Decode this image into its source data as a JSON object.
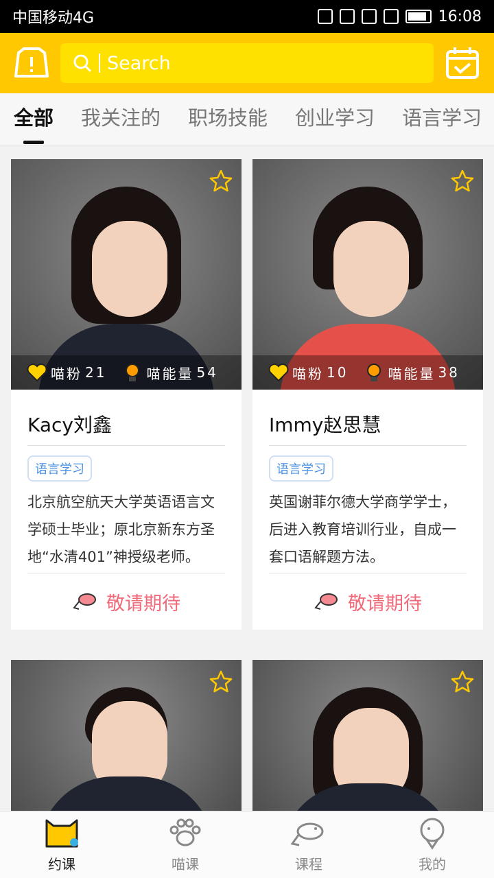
{
  "status": {
    "carrier": "中国移动4G",
    "time": "16:08"
  },
  "search": {
    "placeholder": "Search"
  },
  "tabs": [
    "全部",
    "我关注的",
    "职场技能",
    "创业学习",
    "语言学习"
  ],
  "cards": [
    {
      "name": "Kacy刘鑫",
      "tag": "语言学习",
      "desc": "北京航空航天大学英语语言文学硕士毕业；原北京新东方圣地“水清401”神授级老师。",
      "fans_label": "喵粉",
      "fans": "21",
      "energy_label": "喵能量",
      "energy": "54",
      "cta": "敬请期待"
    },
    {
      "name": "Immy赵思慧",
      "tag": "语言学习",
      "desc": "英国谢菲尔德大学商学学士，后进入教育培训行业，自成一套口语解题方法。",
      "fans_label": "喵粉",
      "fans": "10",
      "energy_label": "喵能量",
      "energy": "38",
      "cta": "敬请期待"
    }
  ],
  "nav": [
    "约课",
    "喵课",
    "课程",
    "我的"
  ],
  "colors": {
    "brand_yellow": "#ffc800",
    "search_yellow": "#ffe100",
    "cta_pink": "#f06a7a",
    "tag_blue": "#4a90e2"
  },
  "icons": {
    "header_left": "bag-alert-icon",
    "header_right": "calendar-check-icon",
    "favorite": "star-outline-icon",
    "fans": "heart-icon",
    "energy": "bulb-icon",
    "cta": "fish-icon"
  }
}
